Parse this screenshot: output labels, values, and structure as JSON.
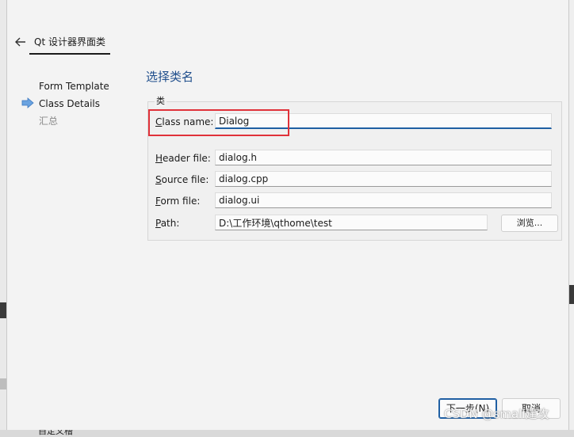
{
  "header": {
    "back_icon": "arrow-left-icon",
    "tab_label": "Qt 设计器界面类"
  },
  "steps": [
    {
      "label": "Form Template",
      "state": "done"
    },
    {
      "label": "Class Details",
      "state": "current"
    },
    {
      "label": "汇总",
      "state": "todo"
    }
  ],
  "page": {
    "title": "选择类名",
    "group_label": "类"
  },
  "form": {
    "class_name": {
      "label_u": "C",
      "label_rest": "lass name:",
      "value": "Dialog"
    },
    "header_file": {
      "label_u": "H",
      "label_rest": "eader file:",
      "value": "dialog.h"
    },
    "source_file": {
      "label_u": "S",
      "label_rest": "ource file:",
      "value": "dialog.cpp"
    },
    "form_file": {
      "label_u": "F",
      "label_rest": "orm file:",
      "value": "dialog.ui"
    },
    "path": {
      "label_pre": "",
      "label_u": "P",
      "label_rest": "ath:",
      "value": "D:\\工作环境\\qthome\\test"
    },
    "browse_label": "浏览..."
  },
  "footer": {
    "next_label": "下一步(N)",
    "cancel_label": "取消"
  },
  "watermark": "CSDN @small建攻",
  "background": {
    "bottom_text": "自定义槽"
  },
  "colors": {
    "accent": "#1f5fa3",
    "title": "#1f4e8c",
    "highlight": "#e0323a"
  }
}
